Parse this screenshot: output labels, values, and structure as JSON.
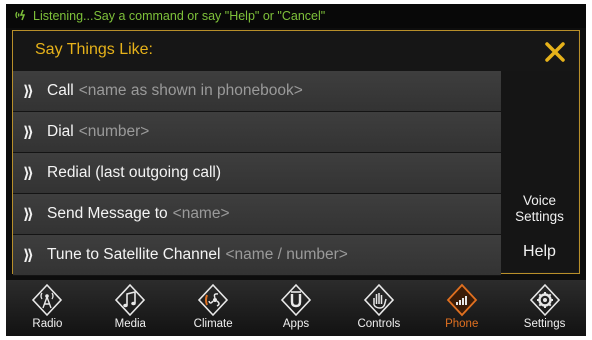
{
  "status": {
    "text": "Listening...Say a command or say \"Help\" or \"Cancel\""
  },
  "panel": {
    "title": "Say Things Like:",
    "close_icon": "close-x-icon",
    "commands": [
      {
        "label": "Call",
        "hint": "<name as shown in phonebook>"
      },
      {
        "label": "Dial",
        "hint": "<number>"
      },
      {
        "label": "Redial (last outgoing call)",
        "hint": ""
      },
      {
        "label": "Send Message to",
        "hint": "<name>"
      },
      {
        "label": "Tune to Satellite Channel",
        "hint": "<name / number>"
      }
    ],
    "side": {
      "voice_settings_line1": "Voice",
      "voice_settings_line2": "Settings",
      "help": "Help"
    }
  },
  "nav": {
    "items": [
      {
        "label": "Radio",
        "icon": "radio-tower-icon"
      },
      {
        "label": "Media",
        "icon": "music-note-icon"
      },
      {
        "label": "Climate",
        "icon": "climate-fan-icon"
      },
      {
        "label": "Apps",
        "icon": "apps-u-icon"
      },
      {
        "label": "Controls",
        "icon": "hand-controls-icon"
      },
      {
        "label": "Phone",
        "icon": "phone-signal-icon",
        "active": true
      },
      {
        "label": "Settings",
        "icon": "gear-icon"
      }
    ]
  },
  "colors": {
    "accent_yellow": "#e6b21a",
    "listening_green": "#7ec13a",
    "active_orange": "#e07020"
  }
}
